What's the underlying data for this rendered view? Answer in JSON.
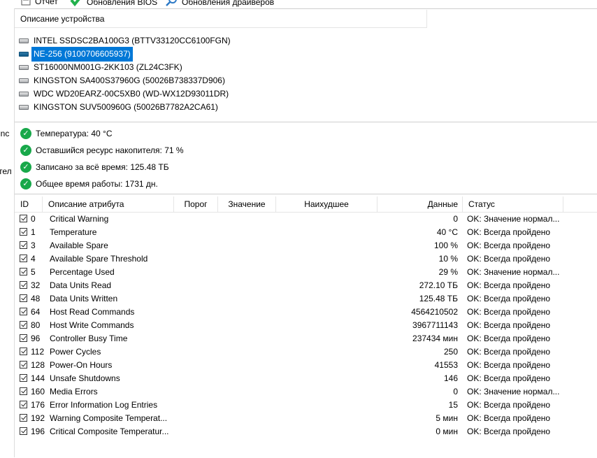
{
  "toolbar": {
    "items": [
      {
        "label": "Отчет",
        "icon": "report-icon"
      },
      {
        "label": "Обновления BIOS",
        "icon": "download-check-icon"
      },
      {
        "label": "Обновления драйверов",
        "icon": "search-icon"
      }
    ]
  },
  "left_fragments": [
    "inc",
    "тел"
  ],
  "devices": {
    "header": "Описание устройства",
    "selected_index": 1,
    "items": [
      "INTEL SSDSC2BA100G3 (BTTV33120CC6100FGN)",
      "NE-256 (9100706605937)",
      "ST16000NM001G-2KK103 (ZL24C3FK)",
      "KINGSTON SA400S37960G (50026B738337D906)",
      "WDC WD20EARZ-00C5XB0 (WD-WX12D93011DR)",
      "KINGSTON SUV500960G (50026B7782A2CA61)"
    ]
  },
  "status": [
    "Температура: 40 °C",
    "Оставшийся ресурс накопителя: 71 %",
    "Записано за всё время: 125.48 ТБ",
    "Общее время работы: 1731 дн."
  ],
  "table": {
    "columns": {
      "id": "ID",
      "name": "Описание атрибута",
      "threshold": "Порог",
      "value": "Значение",
      "worst": "Наихудшее",
      "data": "Данные",
      "status": "Статус"
    },
    "rows": [
      {
        "id": "0",
        "name": "Critical Warning",
        "data": "0",
        "status": "OK: Значение нормал..."
      },
      {
        "id": "1",
        "name": "Temperature",
        "data": "40 °C",
        "status": "OK: Всегда пройдено"
      },
      {
        "id": "3",
        "name": "Available Spare",
        "data": "100 %",
        "status": "OK: Всегда пройдено"
      },
      {
        "id": "4",
        "name": "Available Spare Threshold",
        "data": "10 %",
        "status": "OK: Всегда пройдено"
      },
      {
        "id": "5",
        "name": "Percentage Used",
        "data": "29 %",
        "status": "OK: Значение нормал..."
      },
      {
        "id": "32",
        "name": "Data Units Read",
        "data": "272.10 ТБ",
        "status": "OK: Всегда пройдено"
      },
      {
        "id": "48",
        "name": "Data Units Written",
        "data": "125.48 ТБ",
        "status": "OK: Всегда пройдено"
      },
      {
        "id": "64",
        "name": "Host Read Commands",
        "data": "4564210502",
        "status": "OK: Всегда пройдено"
      },
      {
        "id": "80",
        "name": "Host Write Commands",
        "data": "3967711143",
        "status": "OK: Всегда пройдено"
      },
      {
        "id": "96",
        "name": "Controller Busy Time",
        "data": "237434 мин",
        "status": "OK: Всегда пройдено"
      },
      {
        "id": "112",
        "name": "Power Cycles",
        "data": "250",
        "status": "OK: Всегда пройдено"
      },
      {
        "id": "128",
        "name": "Power-On Hours",
        "data": "41553",
        "status": "OK: Всегда пройдено"
      },
      {
        "id": "144",
        "name": "Unsafe Shutdowns",
        "data": "146",
        "status": "OK: Всегда пройдено"
      },
      {
        "id": "160",
        "name": "Media Errors",
        "data": "0",
        "status": "OK: Значение нормал..."
      },
      {
        "id": "176",
        "name": "Error Information Log Entries",
        "data": "15",
        "status": "OK: Всегда пройдено"
      },
      {
        "id": "192",
        "name": "Warning Composite Temperat...",
        "data": "5 мин",
        "status": "OK: Всегда пройдено"
      },
      {
        "id": "196",
        "name": "Critical Composite Temperatur...",
        "data": "0 мин",
        "status": "OK: Всегда пройдено"
      }
    ]
  }
}
